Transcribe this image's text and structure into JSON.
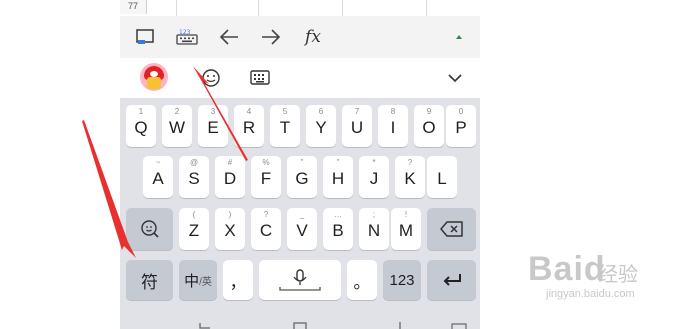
{
  "sheet": {
    "row_number": "77"
  },
  "toolbar": {
    "fx_label": "fx"
  },
  "keys": {
    "row1": [
      {
        "main": "Q",
        "hint": "1"
      },
      {
        "main": "W",
        "hint": "2"
      },
      {
        "main": "E",
        "hint": "3"
      },
      {
        "main": "R",
        "hint": "4"
      },
      {
        "main": "T",
        "hint": "5"
      },
      {
        "main": "Y",
        "hint": "6"
      },
      {
        "main": "U",
        "hint": "7"
      },
      {
        "main": "I",
        "hint": "8"
      },
      {
        "main": "O",
        "hint": "9"
      },
      {
        "main": "P",
        "hint": "0"
      }
    ],
    "row2": [
      {
        "main": "A",
        "hint": "~"
      },
      {
        "main": "S",
        "hint": "@"
      },
      {
        "main": "D",
        "hint": "#"
      },
      {
        "main": "F",
        "hint": "%"
      },
      {
        "main": "G",
        "hint": "\""
      },
      {
        "main": "H",
        "hint": "\""
      },
      {
        "main": "J",
        "hint": "*"
      },
      {
        "main": "K",
        "hint": "?"
      },
      {
        "main": "L",
        "hint": ""
      }
    ],
    "row3": [
      {
        "main": "Z",
        "hint": "("
      },
      {
        "main": "X",
        "hint": ")"
      },
      {
        "main": "C",
        "hint": "?"
      },
      {
        "main": "V",
        "hint": "_"
      },
      {
        "main": "B",
        "hint": "…"
      },
      {
        "main": "N",
        "hint": ";"
      },
      {
        "main": "M",
        "hint": "!"
      }
    ],
    "symbols_label": "符",
    "lang_main": "中",
    "lang_alt": "/英",
    "comma": "，",
    "period": "。",
    "numbers_label": "123"
  },
  "watermark": {
    "brand": "Baid",
    "brand_cn": "经验",
    "url": "jingyan.baidu.com"
  },
  "colors": {
    "keyboard_bg": "#e0e2e7",
    "key_bg": "#ffffff",
    "function_key_bg": "#c5c9d2",
    "arrow_red": "#e8312f"
  }
}
